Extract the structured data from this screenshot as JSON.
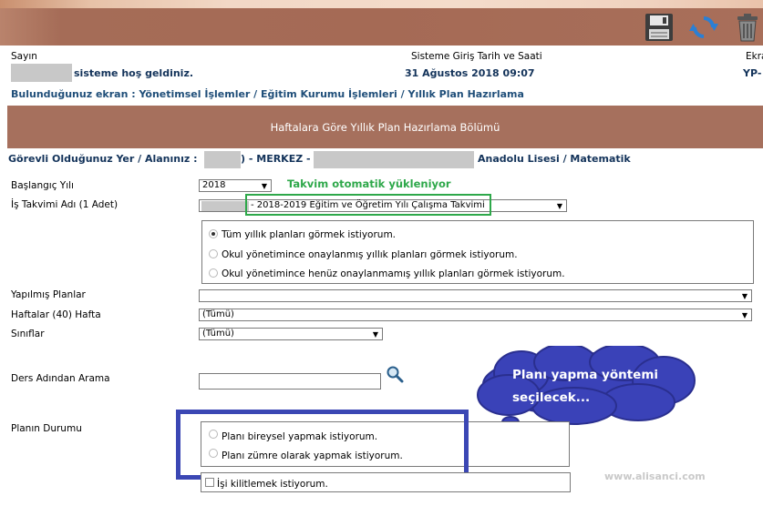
{
  "header": {
    "greeting_label": "Sayın",
    "welcome_text": "sisteme hoş geldiniz.",
    "login_label": "Sisteme Giriş Tarih ve Saati",
    "login_datetime": "31 Ağustos 2018 09:07",
    "screen_label_partial": "Ekra",
    "yp_partial": "YP-"
  },
  "breadcrumb": "Bulunduğunuz ekran : Yönetimsel İşlemler / Eğitim Kurumu İşlemleri / Yıllık Plan Hazırlama",
  "section_title": "Haftalara Göre Yıllık Plan Hazırlama Bölümü",
  "duty_location": {
    "label": "Görevli Olduğunuz Yer / Alanınız :",
    "merkez": ") - MERKEZ -",
    "school": "Anadolu Lisesi / Matematik"
  },
  "form": {
    "start_year_label": "Başlangıç Yılı",
    "start_year_value": "2018",
    "calendar_label": "İş Takvimi Adı (1 Adet)",
    "calendar_value": "- 2018-2019 Eğitim ve Öğretim Yılı Çalışma Takvimi",
    "plan_view_options": [
      {
        "label": "Tüm yıllık planları görmek istiyorum.",
        "selected": true
      },
      {
        "label": "Okul yönetimince onaylanmış yıllık planları görmek istiyorum.",
        "selected": false
      },
      {
        "label": "Okul yönetimince henüz onaylanmamış yıllık planları görmek istiyorum.",
        "selected": false
      }
    ],
    "made_plans_label": "Yapılmış Planlar",
    "made_plans_value": "",
    "weeks_label": "Haftalar (40) Hafta",
    "weeks_value": "(Tümü)",
    "classes_label": "Sınıflar",
    "classes_value": "(Tümü)",
    "search_label": "Ders Adından Arama",
    "search_value": "",
    "plan_status_label": "Planın Durumu",
    "plan_status_options": [
      {
        "label": "Planı bireysel yapmak istiyorum.",
        "selected": false
      },
      {
        "label": "Planı zümre olarak yapmak istiyorum.",
        "selected": false
      }
    ],
    "lock_label": "İşi kilitlemek istiyorum."
  },
  "annotations": {
    "auto_load_note": "Takvim otomatik yükleniyor",
    "cloud_line1": "Planı yapma yöntemi",
    "cloud_line2": "seçilecek..."
  },
  "watermark": "www.alisanci.com",
  "colors": {
    "toolbar": "#a56a55",
    "header_band": "#a6705d",
    "breadcrumb": "#1f4e79",
    "highlight_green": "#2ea84a",
    "highlight_blue": "#3b47b4",
    "cloud": "#3a42b8"
  },
  "icons": [
    "save-icon",
    "refresh-icon",
    "delete-icon",
    "search-icon"
  ]
}
